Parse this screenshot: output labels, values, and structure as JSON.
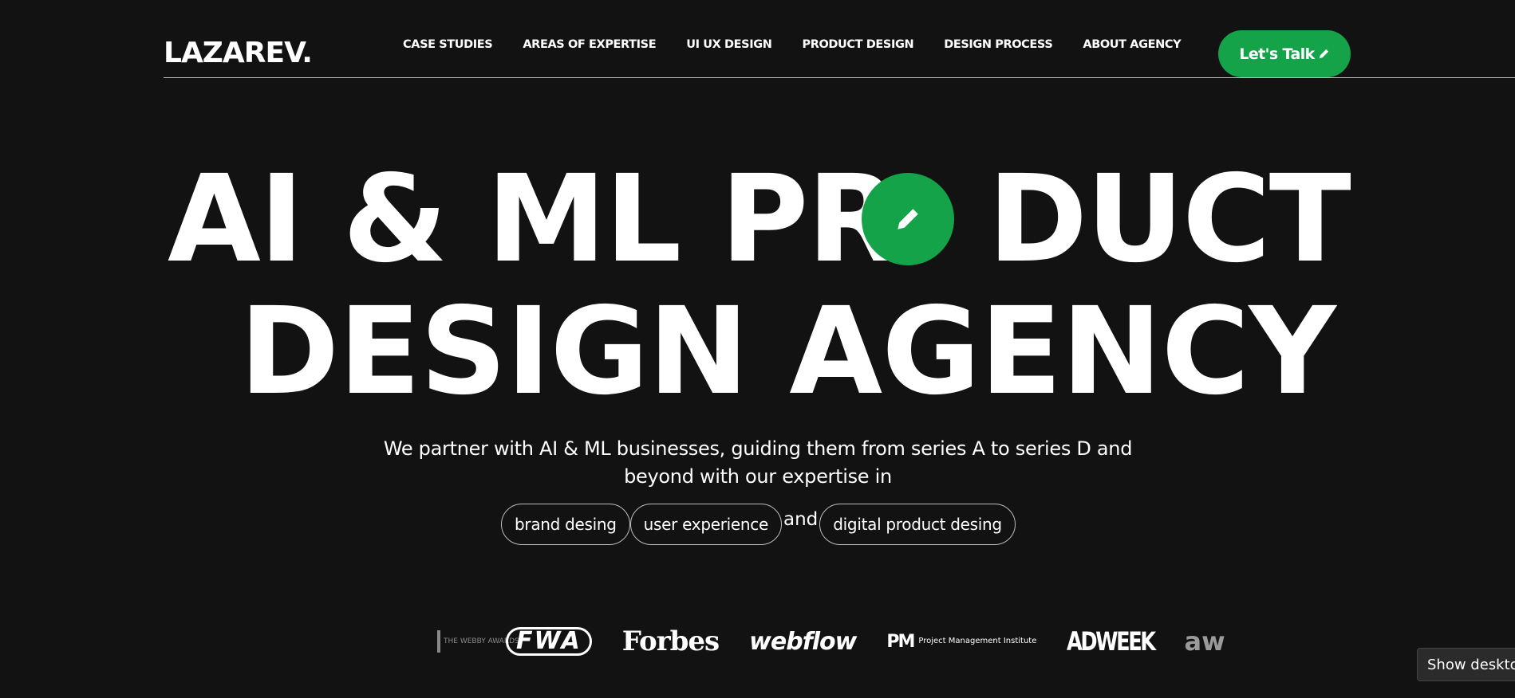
{
  "header": {
    "logo": "LAZAREV.",
    "nav": [
      {
        "label": "CASE STUDIES"
      },
      {
        "label": "AREAS OF EXPERTISE"
      },
      {
        "label": "UI UX DESIGN"
      },
      {
        "label": "PRODUCT DESIGN"
      },
      {
        "label": "DESIGN PROCESS"
      },
      {
        "label": "ABOUT AGENCY"
      }
    ],
    "cta_label": "Let's Talk",
    "cta_icon": "pencil-icon",
    "accent_color": "#15a34a"
  },
  "hero": {
    "line1_left": "AI & ML PR",
    "line1_right": "DUCT",
    "line2": "DESIGN AGENCY",
    "o_icon": "pencil-icon",
    "subtitle": "We partner with AI & ML businesses, guiding them from series A to series D and beyond with our expertise in",
    "chips": [
      "brand desing",
      "user experience",
      "digital product desing"
    ],
    "chip_joiner": "and"
  },
  "clients": {
    "logos": [
      {
        "name": "webby-logo",
        "text": "THE WEBBY AWARDS"
      },
      {
        "name": "fwa-logo",
        "text": "FWA"
      },
      {
        "name": "forbes-logo",
        "text": "Forbes"
      },
      {
        "name": "webflow-logo",
        "text": "webflow"
      },
      {
        "name": "pmi-logo",
        "mark": "PM",
        "text": "Project Management Institute"
      },
      {
        "name": "adweek-logo",
        "text": "ADWEEK"
      },
      {
        "name": "awwwards-logo",
        "text": "aw"
      }
    ]
  },
  "tooltip": "Show desktop"
}
